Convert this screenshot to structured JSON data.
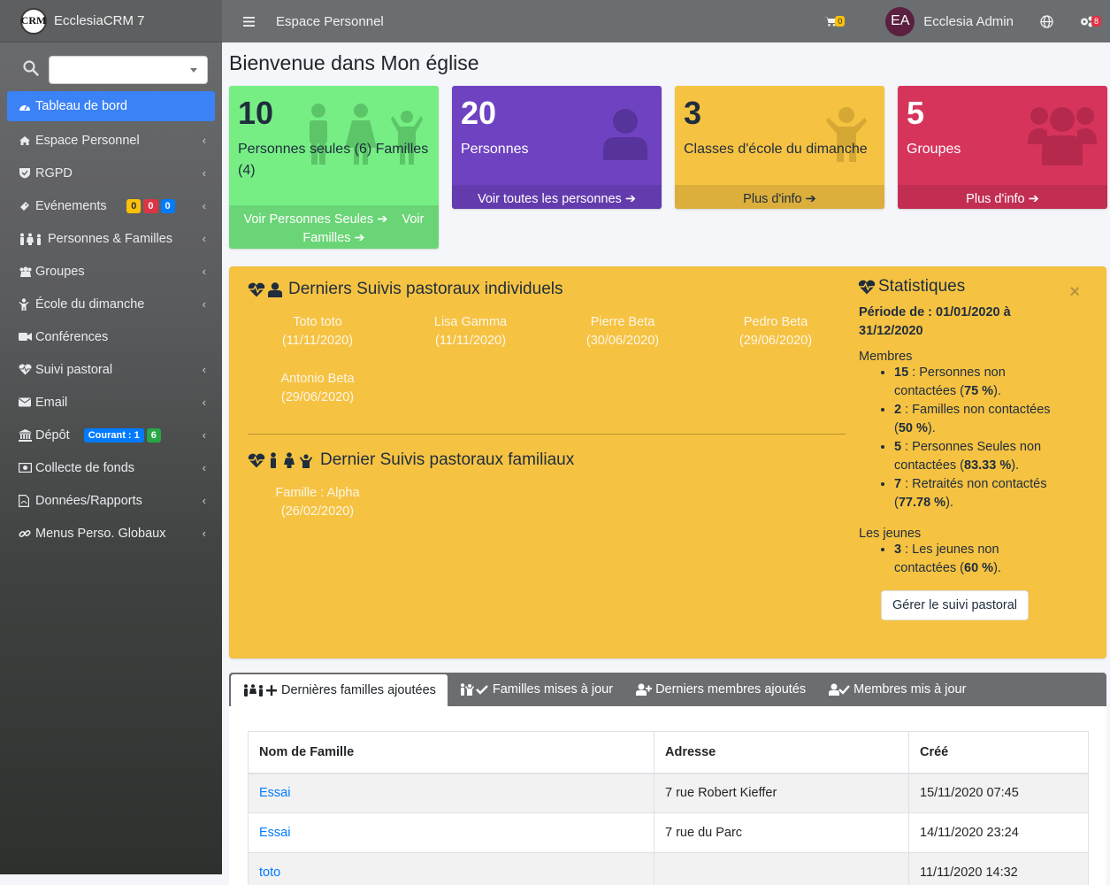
{
  "brand": {
    "logo_text": "CRM",
    "name": "EcclesiaCRM 7"
  },
  "topbar": {
    "title": "Espace Personnel",
    "cart_count": "0",
    "user_initials": "EA",
    "user_name": "Ecclesia Admin",
    "settings_count": "8"
  },
  "sidebar": {
    "items": [
      {
        "label": "Tableau de bord"
      },
      {
        "label": "Espace Personnel"
      },
      {
        "label": "RGPD"
      },
      {
        "label": "Evénements",
        "badges": [
          "0",
          "0",
          "0"
        ]
      },
      {
        "label": "Personnes & Familles"
      },
      {
        "label": "Groupes"
      },
      {
        "label": "École du dimanche"
      },
      {
        "label": "Conférences"
      },
      {
        "label": "Suivi pastoral"
      },
      {
        "label": "Email"
      },
      {
        "label": "Dépôt",
        "badges": [
          "Courant : 1",
          "6"
        ]
      },
      {
        "label": "Collecte de fonds"
      },
      {
        "label": "Données/Rapports"
      },
      {
        "label": "Menus Perso. Globaux"
      }
    ]
  },
  "page_title": "Bienvenue dans Mon église",
  "boxes": [
    {
      "number": "10",
      "text": "Personnes seules (6) Familles (4)",
      "footer_a": "Voir Personnes Seules",
      "footer_b": "Voir Familles"
    },
    {
      "number": "20",
      "text": "Personnes",
      "footer": "Voir toutes les personnes"
    },
    {
      "number": "3",
      "text": "Classes d'école du dimanche",
      "footer": "Plus d'info"
    },
    {
      "number": "5",
      "text": "Groupes",
      "footer": "Plus d'info"
    }
  ],
  "pastoral": {
    "individual_title": "Derniers Suivis pastoraux individuels",
    "individual": [
      {
        "name": "Toto toto",
        "date": "(11/11/2020)"
      },
      {
        "name": "Lisa Gamma",
        "date": "(11/11/2020)"
      },
      {
        "name": "Pierre Beta",
        "date": "(30/06/2020)"
      },
      {
        "name": "Pedro Beta",
        "date": "(29/06/2020)"
      },
      {
        "name": "Antonio Beta",
        "date": "(29/06/2020)"
      }
    ],
    "family_title": "Dernier Suivis pastoraux familiaux",
    "family": [
      {
        "name": "Famille : Alpha",
        "date": "(26/02/2020)"
      }
    ]
  },
  "stats": {
    "title": "Statistiques",
    "close": "×",
    "period": "Période de : 01/01/2020 à 31/12/2020",
    "members_label": "Membres",
    "members": [
      {
        "count": "15",
        "text": " : Personnes non contactées (",
        "pct": "75 %",
        "end": ")."
      },
      {
        "count": "2",
        "text": " : Familles non contactées (",
        "pct": "50 %",
        "end": ")."
      },
      {
        "count": "5",
        "text": " : Personnes Seules non contactées (",
        "pct": "83.33 %",
        "end": ")."
      },
      {
        "count": "7",
        "text": " : Retraités non contactés (",
        "pct": "77.78 %",
        "end": ")."
      }
    ],
    "youth_label": "Les jeunes",
    "youth": [
      {
        "count": "3",
        "text": " : Les jeunes non contactées (",
        "pct": "60 %",
        "end": ")."
      }
    ],
    "button": "Gérer le suivi pastoral"
  },
  "tabs": [
    "Dernières familles ajoutées",
    "Familles mises à jour",
    "Derniers membres ajoutés",
    "Membres mis à jour"
  ],
  "table": {
    "headers": [
      "Nom de Famille",
      "Adresse",
      "Créé"
    ],
    "rows": [
      [
        "Essai",
        "7 rue Robert Kieffer",
        "15/11/2020 07:45"
      ],
      [
        "Essai",
        "7 rue du Parc",
        "14/11/2020 23:24"
      ],
      [
        "toto",
        "",
        "11/11/2020 14:32"
      ]
    ]
  },
  "colors": {
    "accent": "#3b82f6",
    "box_green": "#76ee84",
    "box_purple": "#6f42c1",
    "box_yellow": "#f5c242",
    "box_red": "#d7345c"
  }
}
